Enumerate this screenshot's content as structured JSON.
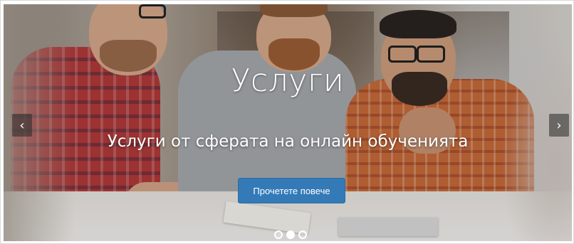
{
  "carousel": {
    "title": "Услуги",
    "subtitle": "Услуги от сферата на онлайн обученията",
    "button_label": "Прочетете повече",
    "prev_icon": "chevron-left-icon",
    "next_icon": "chevron-right-icon",
    "slide_count": 3,
    "active_slide": 1,
    "colors": {
      "button": "#337ab7",
      "caption_text": "#ffffff",
      "arrow_background": "#282828"
    }
  }
}
